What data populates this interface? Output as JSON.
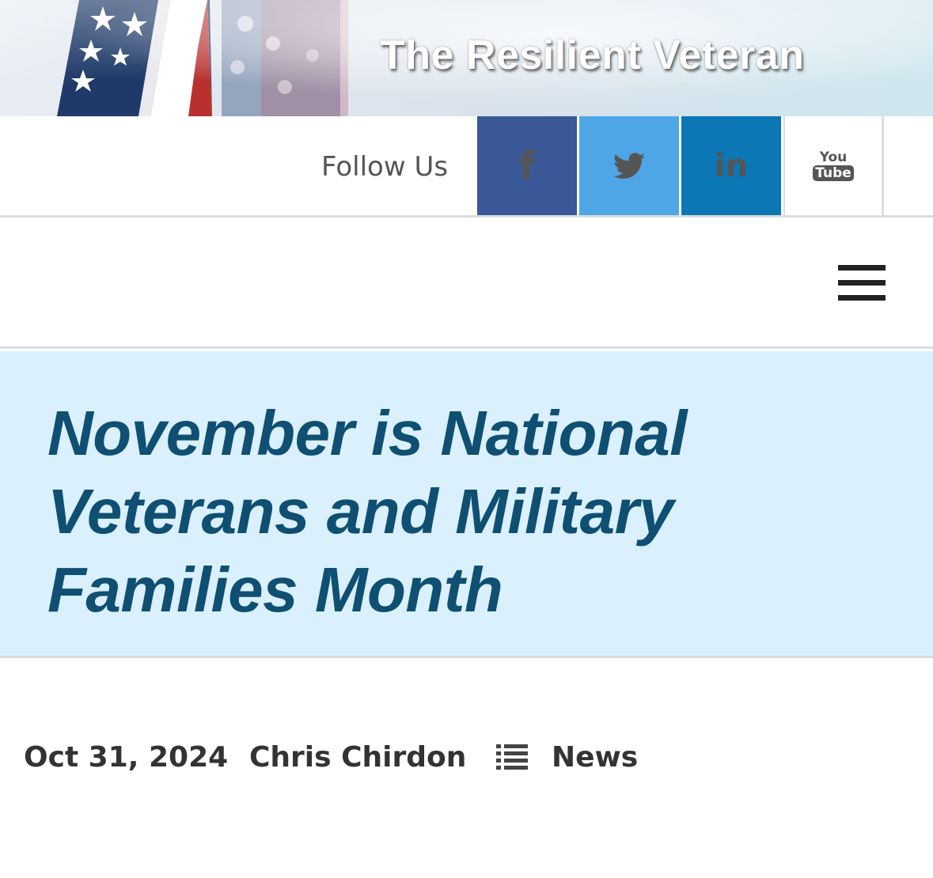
{
  "header": {
    "site_title": "The Resilient Veteran"
  },
  "follow": {
    "label": "Follow Us",
    "social": [
      {
        "name": "facebook",
        "icon": "facebook-icon",
        "glyph": "f",
        "bg": "#3b5998"
      },
      {
        "name": "twitter",
        "icon": "twitter-icon",
        "glyph": "",
        "bg": "#4ea6e6"
      },
      {
        "name": "linkedin",
        "icon": "linkedin-icon",
        "glyph": "in",
        "bg": "#0b77b5"
      },
      {
        "name": "youtube",
        "icon": "youtube-icon",
        "you": "You",
        "tube": "Tube",
        "bg": "#ffffff"
      }
    ]
  },
  "nav": {
    "menu_icon": "hamburger-menu-icon"
  },
  "post": {
    "title": "November is National Veterans and Military Families Month",
    "date": "Oct 31, 2024",
    "author": "Chris Chirdon",
    "category_icon": "list-icon",
    "category": "News"
  },
  "colors": {
    "title_band_bg": "#daf0fc",
    "title_text": "#0f4f72",
    "meta_text": "#333333"
  }
}
